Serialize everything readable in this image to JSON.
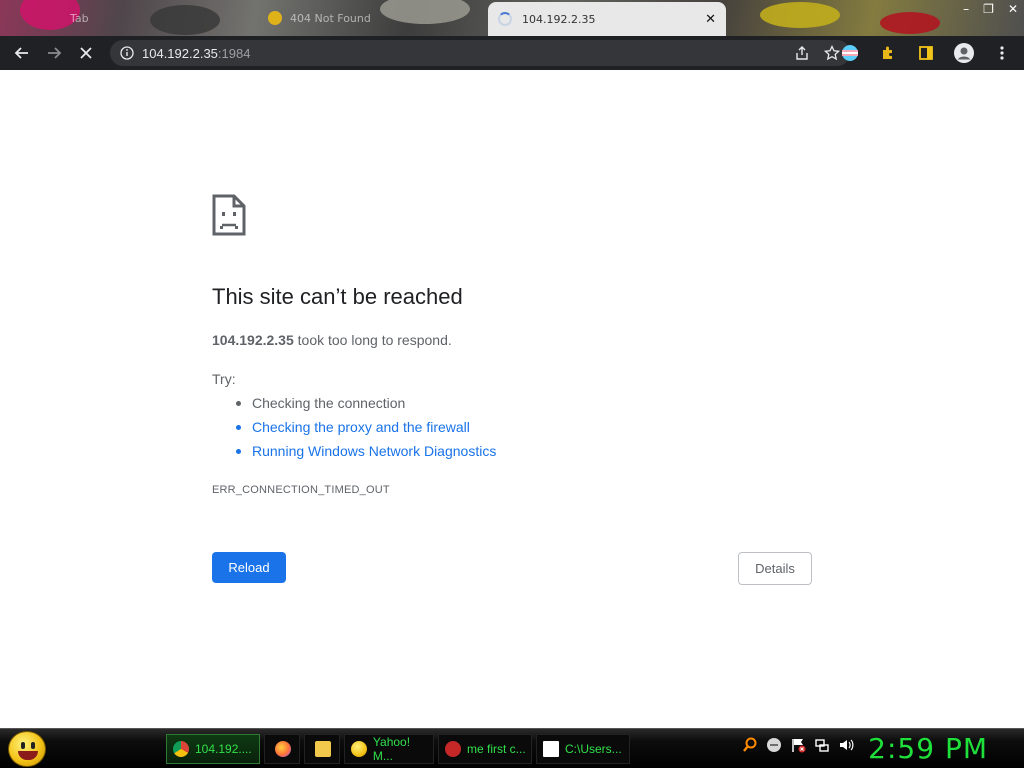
{
  "browser": {
    "tabs": [
      {
        "label": "Tab",
        "active": false
      },
      {
        "label": "404 Not Found",
        "active": false
      },
      {
        "label": "104.192.2.35",
        "active": true,
        "loading": true
      }
    ],
    "tab_close": "✕",
    "window_controls": {
      "minimize": "–",
      "maximize": "❐",
      "close": "✕"
    },
    "address": {
      "host": "104.192.2.35",
      "port": ":1984"
    }
  },
  "page": {
    "title": "This site can’t be reached",
    "desc_host": "104.192.2.35",
    "desc_rest": " took too long to respond.",
    "try_label": "Try:",
    "suggestions": [
      {
        "text": "Checking the connection",
        "link": false
      },
      {
        "text": "Checking the proxy and the firewall",
        "link": true
      },
      {
        "text": "Running Windows Network Diagnostics",
        "link": true
      }
    ],
    "error_code": "ERR_CONNECTION_TIMED_OUT",
    "reload_label": "Reload",
    "details_label": "Details"
  },
  "taskbar": {
    "items": [
      {
        "label": "104.192....",
        "icon": "chrome-icon",
        "active": true
      },
      {
        "label": "",
        "icon": "firefox-icon",
        "active": false
      },
      {
        "label": "",
        "icon": "folder-icon",
        "active": false
      },
      {
        "label": "Yahoo! M...",
        "icon": "yahoo-messenger-icon",
        "active": false
      },
      {
        "label": "me first c...",
        "icon": "app-icon",
        "active": false
      },
      {
        "label": "C:\\Users...",
        "icon": "7zip-icon",
        "active": false
      }
    ],
    "clock": "2:59 PM"
  },
  "colors": {
    "accent": "#1a73e8",
    "toolbar_bg": "#202124",
    "taskbar_text": "#31e04a"
  }
}
